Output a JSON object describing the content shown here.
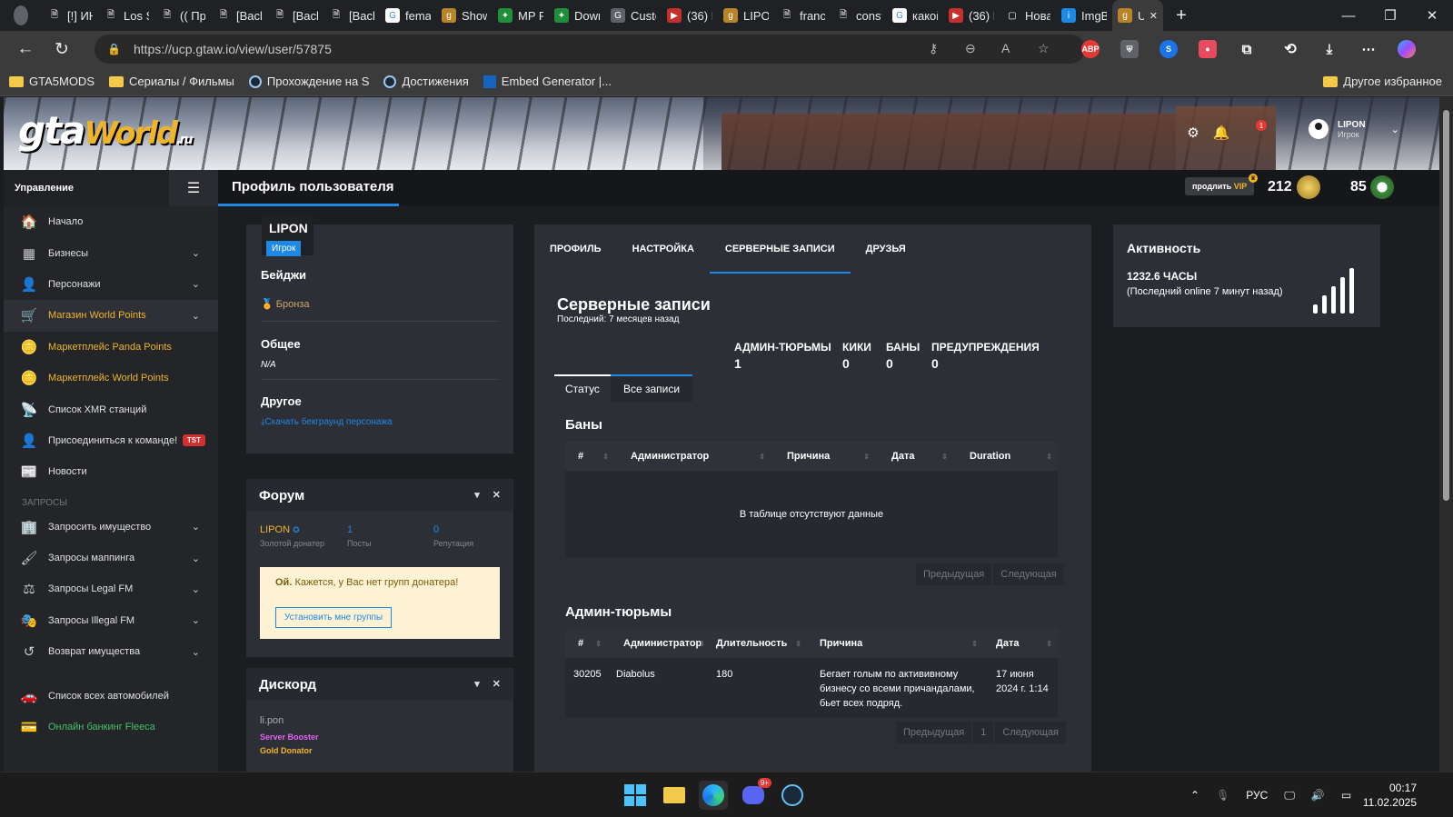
{
  "browser": {
    "tabs": [
      {
        "label": "[!] ИН",
        "fav": "doc-icon"
      },
      {
        "label": "Los Sa",
        "fav": "doc-icon"
      },
      {
        "label": "(( Про",
        "fav": "doc-icon"
      },
      {
        "label": "[Back",
        "fav": "doc-icon"
      },
      {
        "label": "[Back",
        "fav": "doc-icon"
      },
      {
        "label": "[Back",
        "fav": "doc-icon"
      },
      {
        "label": "femal",
        "fav": "google-icon"
      },
      {
        "label": "Showi",
        "fav": "gtaw-icon"
      },
      {
        "label": "MP Fe",
        "fav": "mp-icon"
      },
      {
        "label": "Down",
        "fav": "mp-icon"
      },
      {
        "label": "Custo",
        "fav": "g-icon"
      },
      {
        "label": "(36) M",
        "fav": "youtube-icon"
      },
      {
        "label": "LIPON",
        "fav": "gtaw-icon"
      },
      {
        "label": "france",
        "fav": "doc-icon"
      },
      {
        "label": "consta",
        "fav": "doc-icon"
      },
      {
        "label": "какой",
        "fav": "google-icon"
      },
      {
        "label": "(36) K",
        "fav": "youtube-icon"
      },
      {
        "label": "Новая",
        "fav": "newtab-icon"
      },
      {
        "label": "ImgBE",
        "fav": "ibb-icon"
      },
      {
        "label": "U",
        "fav": "gtaw-icon"
      }
    ],
    "url": "https://ucp.gtaw.io/view/user/57875",
    "bookmarks": [
      {
        "label": "GTA5MODS",
        "type": "folder"
      },
      {
        "label": "Сериалы / Фильмы",
        "type": "folder"
      },
      {
        "label": "Прохождение на S",
        "type": "steam"
      },
      {
        "label": "Достижения",
        "type": "steam"
      },
      {
        "label": "Embed Generator |...",
        "type": "link"
      }
    ],
    "other_bookmarks": "Другое избранное",
    "ext_abp": "ABP"
  },
  "header": {
    "logo_gta": "gta",
    "logo_world": "World",
    "logo_ru": ".ru",
    "notif_count": "1",
    "user_name": "LIPON",
    "user_role": "Игрок"
  },
  "sidebar": {
    "title": "Управление",
    "items": [
      {
        "label": "Начало",
        "icon": "🏠",
        "chev": false,
        "style": ""
      },
      {
        "label": "Бизнесы",
        "icon": "▦",
        "chev": true,
        "style": ""
      },
      {
        "label": "Персонажи",
        "icon": "👤",
        "chev": true,
        "style": ""
      },
      {
        "label": "Магазин World Points",
        "icon": "🛒",
        "chev": true,
        "style": "active"
      },
      {
        "label": "Маркетплейс Panda Points",
        "icon": "🪙",
        "chev": false,
        "style": "gold"
      },
      {
        "label": "Маркетплейс World Points",
        "icon": "🪙",
        "chev": false,
        "style": "gold"
      },
      {
        "label": "Список XMR станций",
        "icon": "📡",
        "chev": false,
        "style": ""
      },
      {
        "label": "Присоединиться к команде!",
        "icon": "👤",
        "chev": false,
        "style": "",
        "tag": "TST"
      },
      {
        "label": "Новости",
        "icon": "📰",
        "chev": false,
        "style": ""
      }
    ],
    "section": "ЗАПРОСЫ",
    "items2": [
      {
        "label": "Запросить имущество",
        "icon": "🏢",
        "chev": true,
        "style": ""
      },
      {
        "label": "Запросы маппинга",
        "icon": "🖌",
        "chev": true,
        "style": ""
      },
      {
        "label": "Запросы Legal FM",
        "icon": "⚖",
        "chev": true,
        "style": ""
      },
      {
        "label": "Запросы Illegal FM",
        "icon": "🎭",
        "chev": true,
        "style": ""
      },
      {
        "label": "Возврат имущества",
        "icon": "↺",
        "chev": true,
        "style": ""
      }
    ],
    "items3": [
      {
        "label": "Список всех автомобилей",
        "icon": "🚗",
        "chev": false,
        "style": ""
      },
      {
        "label": "Онлайн банкинг Fleeca",
        "icon": "💳",
        "chev": false,
        "style": "green"
      }
    ]
  },
  "titlebar": {
    "title": "Профиль пользователя",
    "vip_prefix": "продлить",
    "vip_word": "VIP",
    "points1": "212",
    "points2": "85"
  },
  "profile": {
    "name": "LIPON",
    "role": "Игрок",
    "badges_title": "Бейджи",
    "badge": "Бронза",
    "general_title": "Общее",
    "general_value": "N/A",
    "other_title": "Другое",
    "download_link": "Скачать бекграунд персонажа"
  },
  "forum": {
    "title": "Форум",
    "name": "LIPON",
    "name_label": "Золотой донатер",
    "posts": "1",
    "posts_label": "Посты",
    "rep": "0",
    "rep_label": "Репутация",
    "alert_bold": "Ой.",
    "alert_text": "Кажется, у Вас нет групп донатера!",
    "alert_button": "Установить мне группы"
  },
  "discord": {
    "title": "Дискорд",
    "user": "li.pon",
    "role1": "Server Booster",
    "role2": "Gold Donator"
  },
  "main": {
    "tabs": [
      "ПРОФИЛЬ",
      "НАСТРОЙКА",
      "СЕРВЕРНЫЕ ЗАПИСИ",
      "ДРУЗЬЯ"
    ],
    "title": "Серверные записи",
    "subtitle": "Последний: 7 месяцев назад",
    "stats": [
      {
        "label": "АДМИН-ТЮРЬМЫ",
        "value": "1"
      },
      {
        "label": "КИКИ",
        "value": "0"
      },
      {
        "label": "БАНЫ",
        "value": "0"
      },
      {
        "label": "ПРЕДУПРЕЖДЕНИЯ",
        "value": "0"
      }
    ],
    "subtabs": [
      "Статус",
      "Все записи"
    ],
    "bans": {
      "title": "Баны",
      "columns": [
        "#",
        "Администратор",
        "Причина",
        "Дата",
        "Duration"
      ],
      "empty": "В таблице отсутствуют данные",
      "prev": "Предыдущая",
      "next": "Следующая"
    },
    "jails": {
      "title": "Админ-тюрьмы",
      "columns": [
        "#",
        "Администратор",
        "Длительность",
        "Причина",
        "Дата"
      ],
      "rows": [
        {
          "id": "30205",
          "admin": "Diabolus",
          "duration": "180",
          "reason": "Бегает голым по актививному бизнесу со всеми причандалами, бьет всех подряд.",
          "date": "17 июня 2024 г. 1:14"
        }
      ],
      "prev": "Предыдущая",
      "page": "1",
      "next": "Следующая"
    }
  },
  "activity": {
    "title": "Активность",
    "hours": "1232.6 ЧАСЫ",
    "last": "(Последний online 7 минут назад)"
  },
  "taskbar": {
    "discord_badge": "9+",
    "lang": "РУС",
    "time": "00:17",
    "date": "11.02.2025"
  },
  "colors": {
    "accent": "#1e88e5",
    "gold": "#f0b429",
    "green": "#43c16b",
    "bg": "#1b1d21",
    "card": "#2c2f36"
  }
}
